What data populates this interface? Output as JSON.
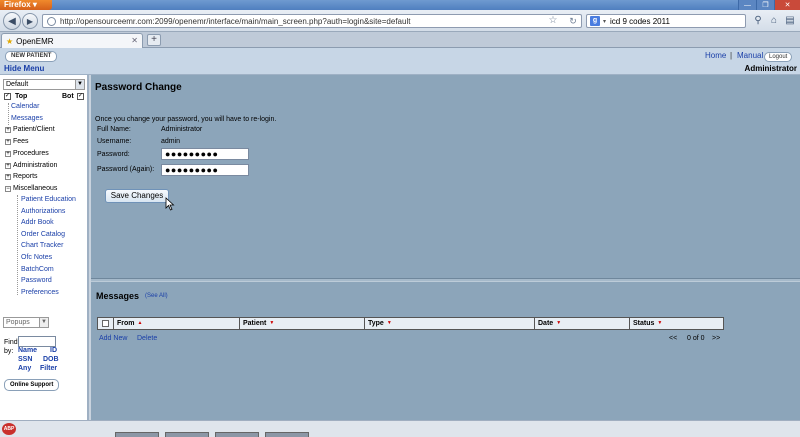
{
  "browser": {
    "app_button": "Firefox",
    "url": "http://opensourceemr.com:2099/openemr/interface/main/main_screen.php?auth=login&site=default",
    "search_text": "icd 9 codes 2011",
    "tab_title": "OpenEMR"
  },
  "header": {
    "new_patient": "NEW PATIENT",
    "hide_menu": "Hide Menu",
    "home": "Home",
    "separator": "|",
    "manual": "Manual",
    "logout": "Logout",
    "user": "Administrator"
  },
  "menu": {
    "select_value": "Default",
    "top_label": "Top",
    "bot_label": "Bot",
    "items": [
      {
        "label": "Calendar"
      },
      {
        "label": "Messages"
      }
    ],
    "categories": [
      {
        "label": "Patient/Client"
      },
      {
        "label": "Fees"
      },
      {
        "label": "Procedures"
      },
      {
        "label": "Administration"
      },
      {
        "label": "Reports"
      },
      {
        "label": "Miscellaneous"
      }
    ],
    "misc_items": [
      {
        "label": "Patient Education"
      },
      {
        "label": "Authorizations"
      },
      {
        "label": "Addr Book"
      },
      {
        "label": "Order Catalog"
      },
      {
        "label": "Chart Tracker"
      },
      {
        "label": "Ofc Notes"
      },
      {
        "label": "BatchCom"
      },
      {
        "label": "Password"
      },
      {
        "label": "Preferences"
      }
    ],
    "popups_value": "Popups",
    "find_label": "Find:",
    "by_label": "by:",
    "by_links": [
      "Name",
      "ID",
      "SSN",
      "DOB",
      "Any",
      "Filter"
    ],
    "online_support": "Online Support"
  },
  "password_change": {
    "title": "Password Change",
    "notice": "Once you change your password, you will have to re-login.",
    "full_name_label": "Full Name:",
    "full_name": "Administrator",
    "username_label": "Username:",
    "username": "admin",
    "password_label": "Password:",
    "password_value": "●●●●●●●●●",
    "password_again_label": "Password (Again):",
    "password_again_value": "●●●●●●●●●",
    "save_button": "Save Changes"
  },
  "messages": {
    "title": "Messages",
    "see_all": "(See All)",
    "columns": [
      "From",
      "Patient",
      "Type",
      "Date",
      "Status"
    ],
    "add_new": "Add New",
    "delete": "Delete",
    "pager_prev": "<<",
    "pager_info": "0 of 0",
    "pager_next": ">>"
  }
}
